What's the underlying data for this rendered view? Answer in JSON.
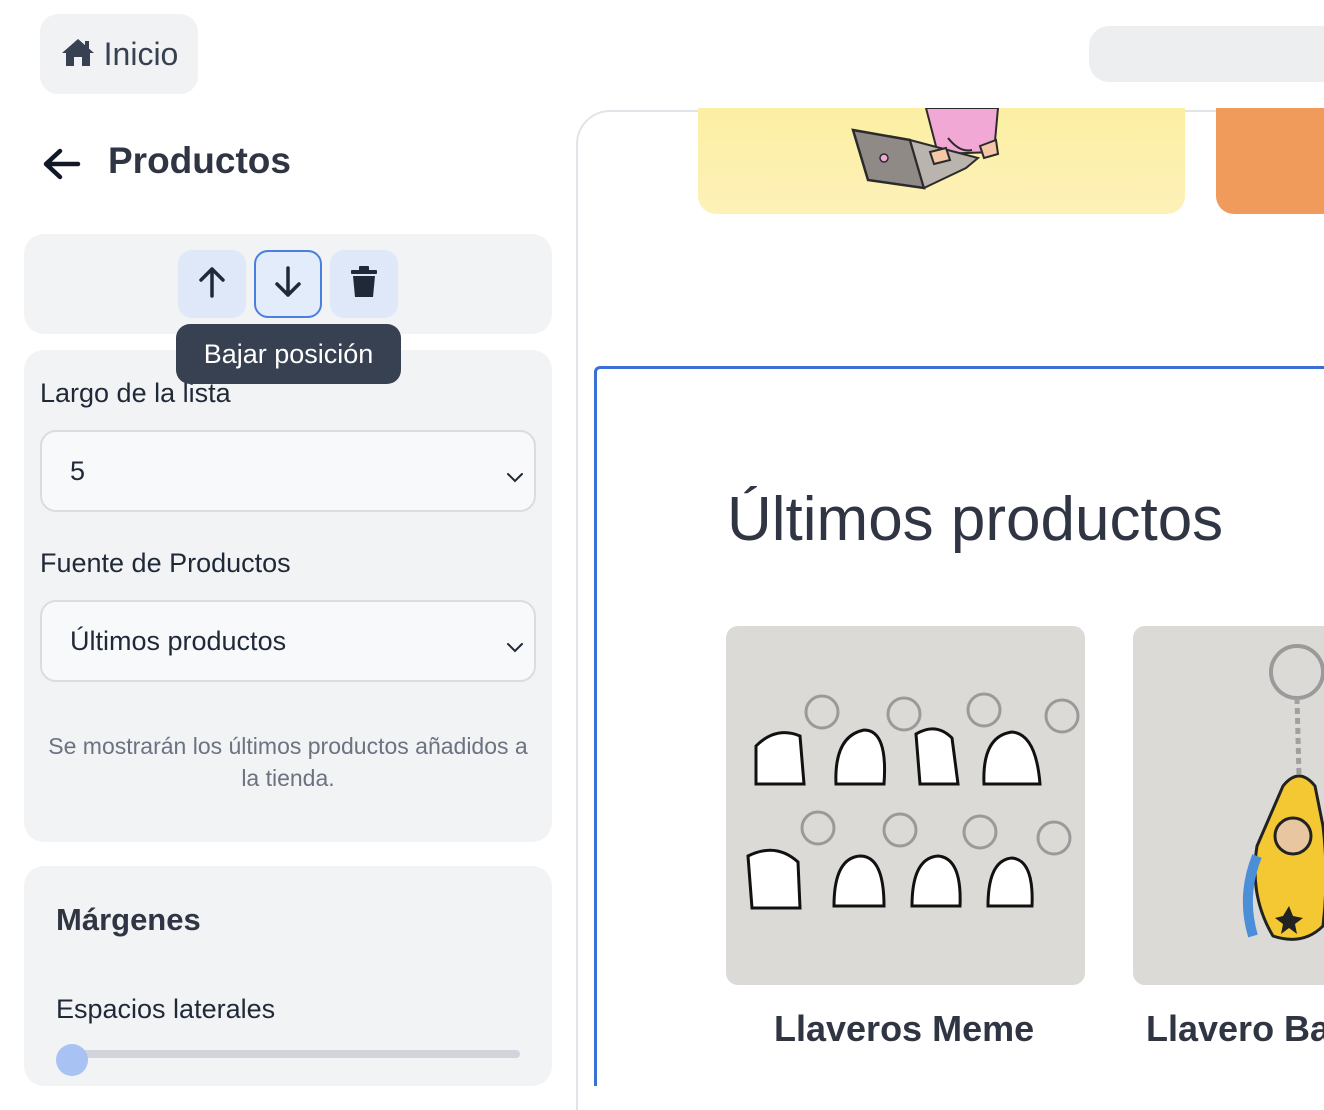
{
  "header": {
    "home_label": "Inicio",
    "home_icon": "home-icon"
  },
  "panel": {
    "title": "Productos",
    "back_icon": "arrow-left-icon"
  },
  "toolbar": {
    "move_up_icon": "arrow-up-icon",
    "move_down_icon": "arrow-down-icon",
    "delete_icon": "trash-icon",
    "tooltip": "Bajar posición"
  },
  "settings": {
    "list_length_label": "Largo de la lista",
    "list_length_value": "5",
    "source_label": "Fuente de Productos",
    "source_value": "Últimos productos",
    "help_text": "Se mostrarán los últimos productos añadidos a la tienda."
  },
  "margins": {
    "title": "Márgenes",
    "lateral_label": "Espacios laterales"
  },
  "preview": {
    "heading": "Últimos productos",
    "products": [
      {
        "name": "Llaveros Meme"
      },
      {
        "name": "Llavero Ba"
      }
    ]
  },
  "colors": {
    "accent": "#3b6fd8",
    "panel_bg": "#f2f3f5",
    "tooltip_bg": "#374151",
    "banner_yellow": "#fcefa3",
    "banner_orange": "#f09a5b"
  }
}
